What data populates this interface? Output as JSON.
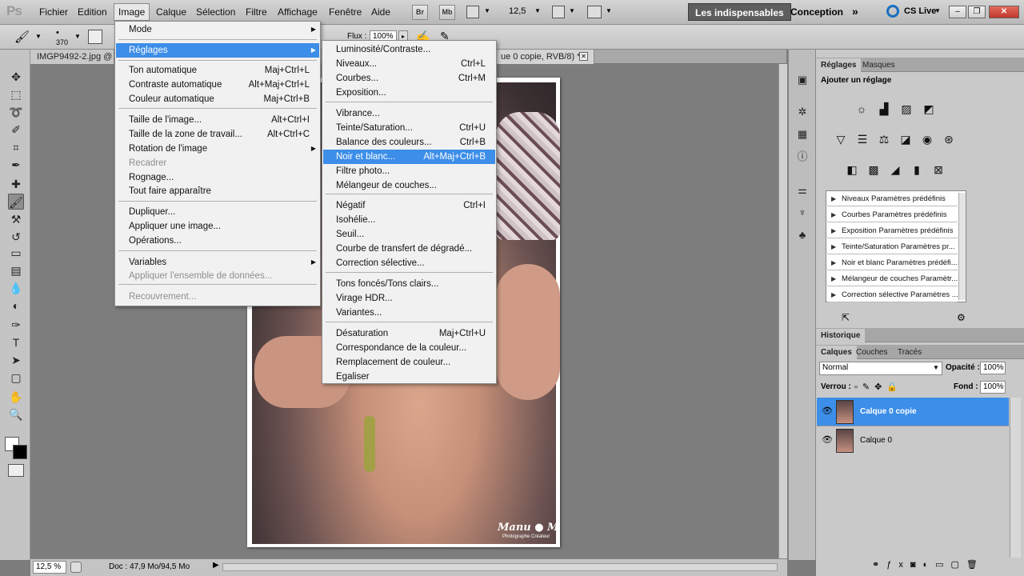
{
  "app": {
    "logo": "Ps"
  },
  "menubar": {
    "items": [
      "Fichier",
      "Edition",
      "Image",
      "Calque",
      "Sélection",
      "Filtre",
      "Affichage",
      "Fenêtre",
      "Aide"
    ],
    "bridge": "Br",
    "minibridge": "Mb",
    "zoom": "12,5",
    "workspaces": [
      "Les indispensables",
      "Conception"
    ],
    "cslive": "CS Live"
  },
  "options": {
    "brush_size": "370",
    "flux_label": "Flux :",
    "flux_value": "100%"
  },
  "document": {
    "tab1": "IMGP9492-2.jpg @",
    "tab2": "ue 0 copie, RVB/8) *",
    "watermark": "Manu ● M",
    "watermark_sub": "Photographe Créateur"
  },
  "status": {
    "zoom": "12,5 %",
    "doc": "Doc : 47,9 Mo/94,5 Mo"
  },
  "image_menu": [
    {
      "label": "Mode",
      "submenu": true
    },
    {
      "label": "Réglages",
      "submenu": true,
      "highlight": true
    },
    {
      "label": "Ton automatique",
      "shortcut": "Maj+Ctrl+L"
    },
    {
      "label": "Contraste automatique",
      "shortcut": "Alt+Maj+Ctrl+L"
    },
    {
      "label": "Couleur automatique",
      "shortcut": "Maj+Ctrl+B"
    },
    {
      "label": "Taille de l'image...",
      "shortcut": "Alt+Ctrl+I"
    },
    {
      "label": "Taille de la zone de travail...",
      "shortcut": "Alt+Ctrl+C"
    },
    {
      "label": "Rotation de l'image",
      "submenu": true
    },
    {
      "label": "Recadrer",
      "disabled": true
    },
    {
      "label": "Rognage..."
    },
    {
      "label": "Tout faire apparaître"
    },
    {
      "label": "Dupliquer..."
    },
    {
      "label": "Appliquer une image..."
    },
    {
      "label": "Opérations..."
    },
    {
      "label": "Variables",
      "submenu": true
    },
    {
      "label": "Appliquer l'ensemble de données...",
      "disabled": true
    },
    {
      "label": "Recouvrement...",
      "disabled": true
    }
  ],
  "reglages_menu": [
    {
      "label": "Luminosité/Contraste..."
    },
    {
      "label": "Niveaux...",
      "shortcut": "Ctrl+L"
    },
    {
      "label": "Courbes...",
      "shortcut": "Ctrl+M"
    },
    {
      "label": "Exposition..."
    },
    {
      "label": "Vibrance..."
    },
    {
      "label": "Teinte/Saturation...",
      "shortcut": "Ctrl+U"
    },
    {
      "label": "Balance des couleurs...",
      "shortcut": "Ctrl+B"
    },
    {
      "label": "Noir et blanc...",
      "shortcut": "Alt+Maj+Ctrl+B",
      "highlight": true
    },
    {
      "label": "Filtre photo..."
    },
    {
      "label": "Mélangeur de couches..."
    },
    {
      "label": "Négatif",
      "shortcut": "Ctrl+I"
    },
    {
      "label": "Isohélie..."
    },
    {
      "label": "Seuil..."
    },
    {
      "label": "Courbe de transfert de dégradé..."
    },
    {
      "label": "Correction sélective..."
    },
    {
      "label": "Tons foncés/Tons clairs..."
    },
    {
      "label": "Virage HDR..."
    },
    {
      "label": "Variantes..."
    },
    {
      "label": "Désaturation",
      "shortcut": "Maj+Ctrl+U"
    },
    {
      "label": "Correspondance de la couleur..."
    },
    {
      "label": "Remplacement de couleur..."
    },
    {
      "label": "Egaliser"
    }
  ],
  "adjust_panel": {
    "tabs": [
      "Réglages",
      "Masques"
    ],
    "title": "Ajouter un réglage",
    "presets": [
      "Niveaux Paramètres prédéfinis",
      "Courbes Paramètres prédéfinis",
      "Exposition Paramètres prédéfinis",
      "Teinte/Saturation Paramètres pr...",
      "Noir et blanc Paramètres prédéfi...",
      "Mélangeur de couches Paramètr...",
      "Correction sélective Paramètres ..."
    ]
  },
  "history_panel": {
    "tab": "Historique"
  },
  "layers_panel": {
    "tabs": [
      "Calques",
      "Couches",
      "Tracés"
    ],
    "blend_mode": "Normal",
    "opacity_label": "Opacité :",
    "opacity_value": "100%",
    "lock_label": "Verrou :",
    "fill_label": "Fond :",
    "fill_value": "100%",
    "layers": [
      "Calque 0 copie",
      "Calque 0"
    ]
  },
  "colors": {
    "highlight": "#3d8ee8",
    "workspace_active": "#5e5e5e"
  }
}
